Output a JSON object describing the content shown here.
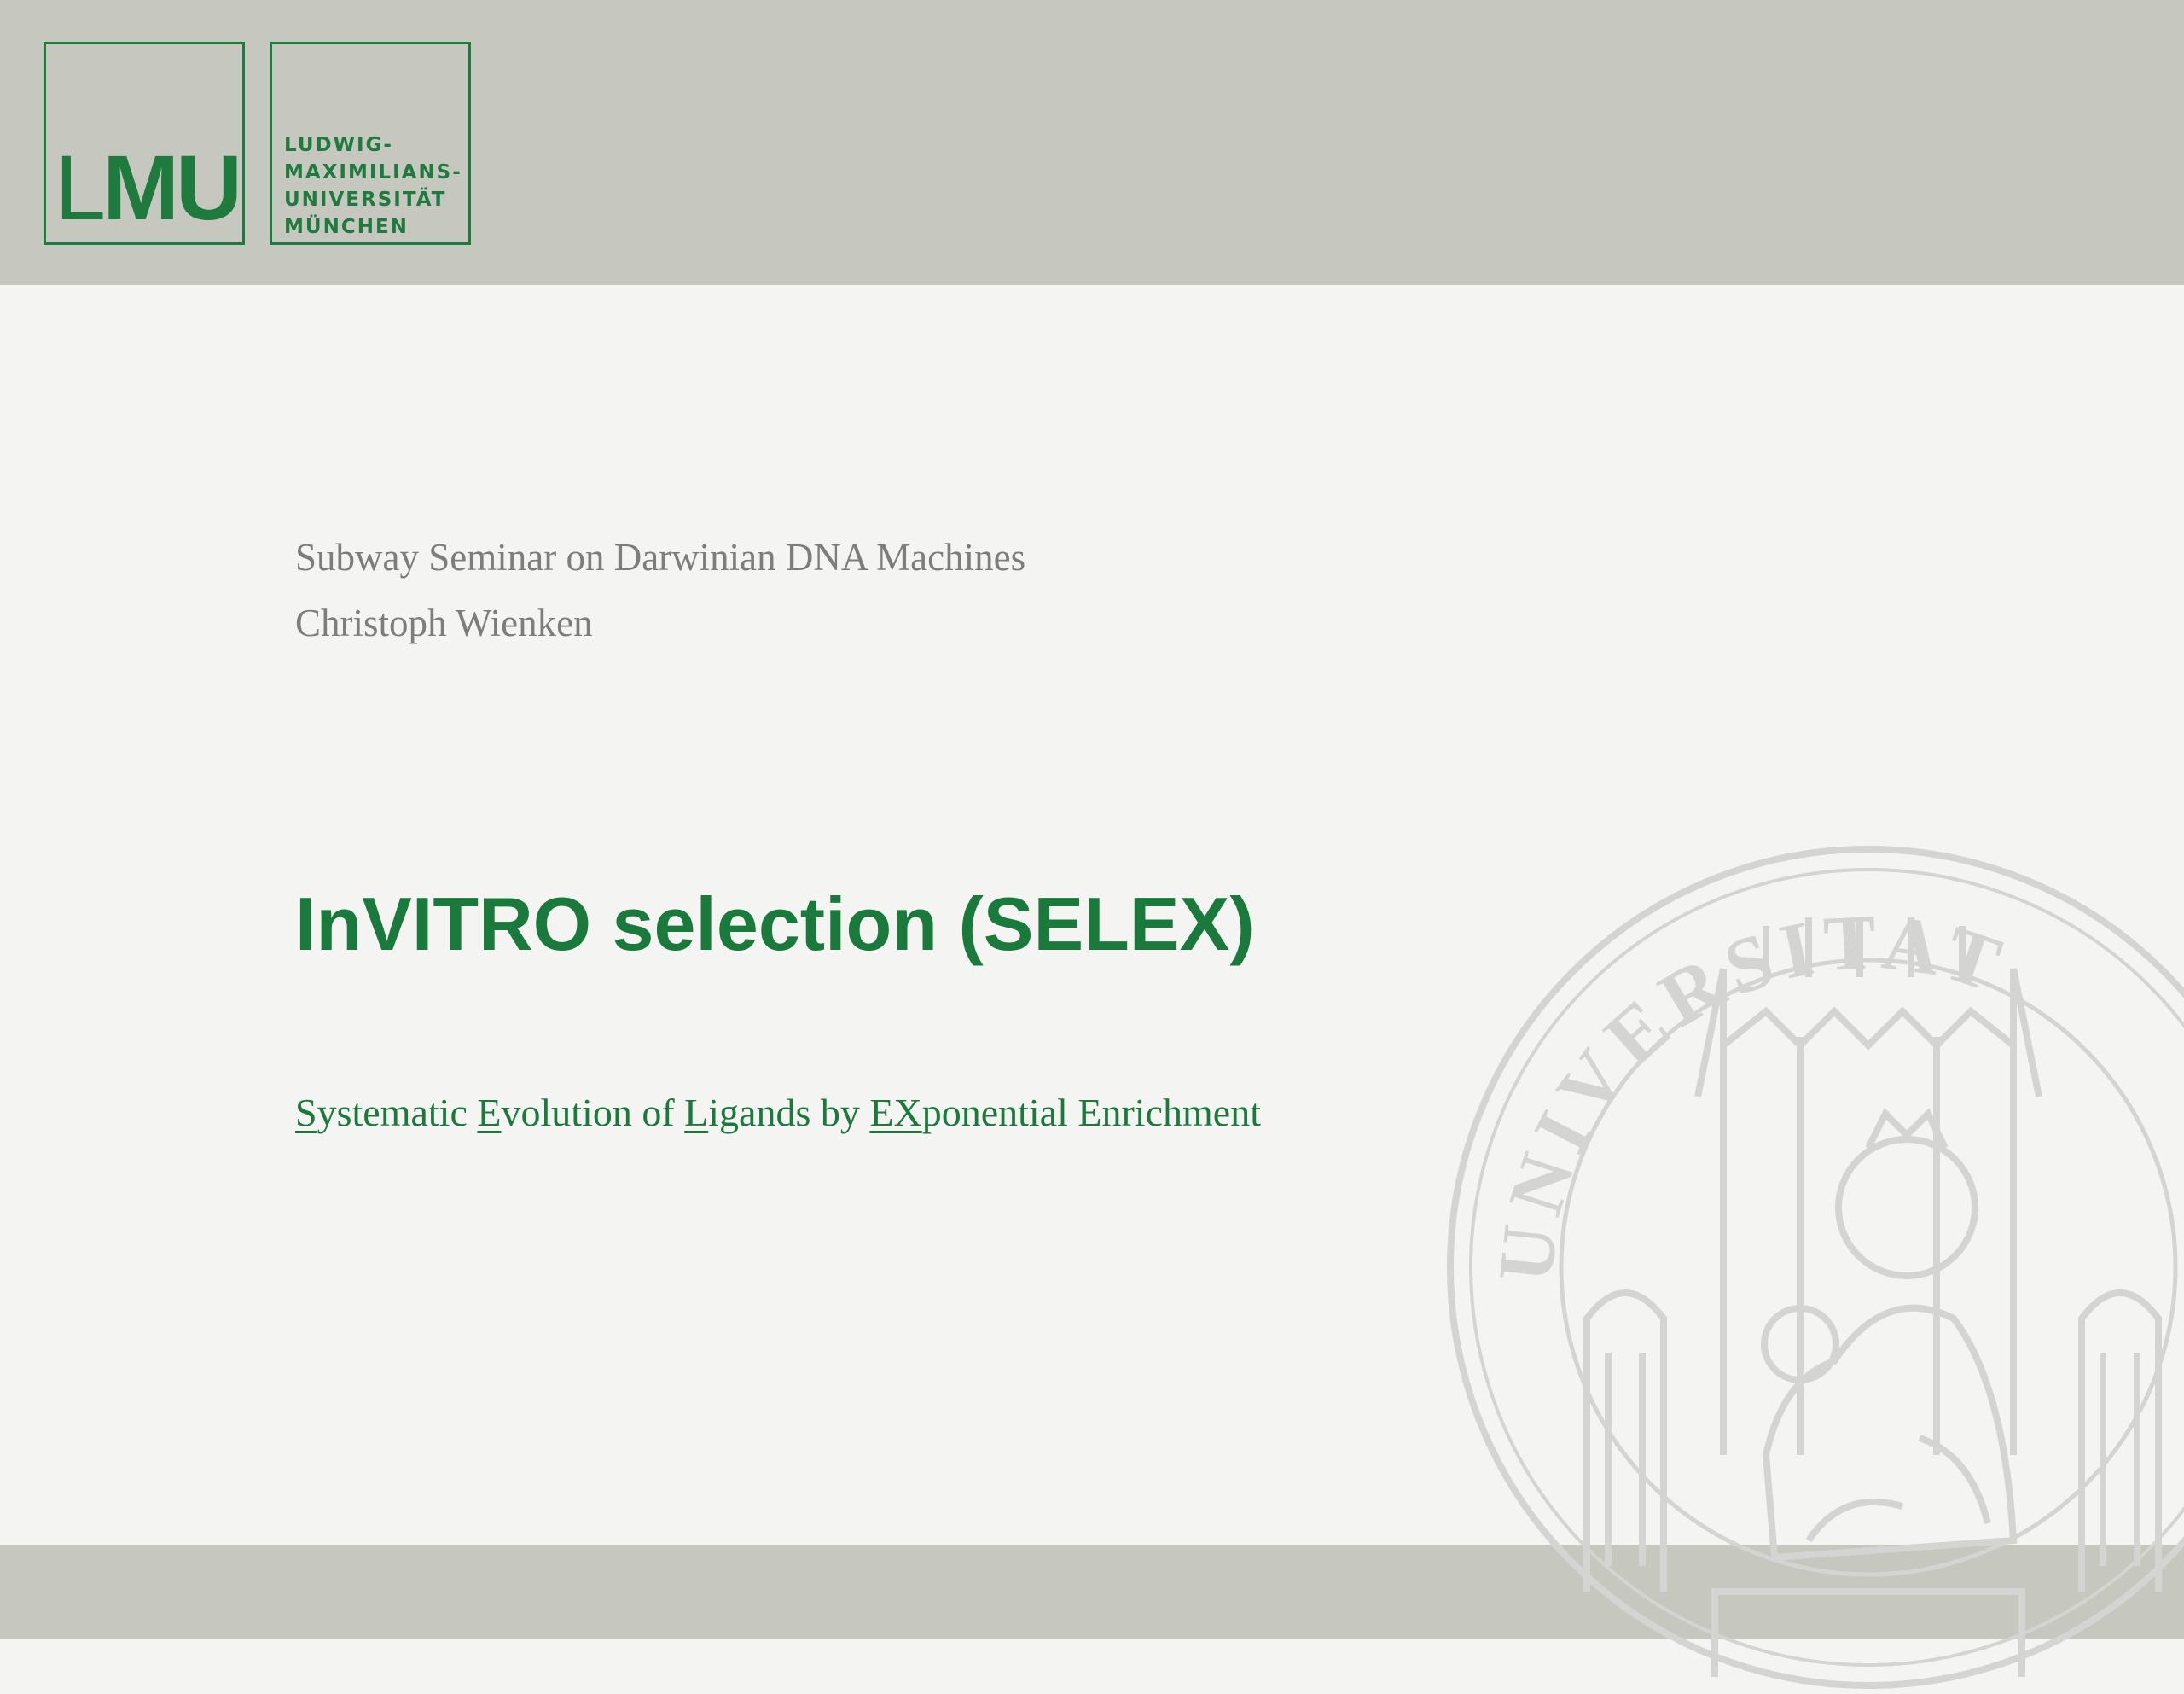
{
  "logo": {
    "mark": {
      "l": "L",
      "mu": "MU"
    },
    "words": [
      "LUDWIG-",
      "MAXIMILIANS-",
      "UNIVERSITÄT",
      "MÜNCHEN"
    ],
    "color": "#1f7a3e"
  },
  "seal": {
    "icon": "university-seal-icon",
    "lettering": "UNIVERSITAT"
  },
  "slide": {
    "seminar": "Subway Seminar on Darwinian DNA Machines",
    "author": "Christoph Wienken",
    "title": "InVITRO selection (SELEX)",
    "acronym_parts": [
      {
        "text": "S",
        "underline": true
      },
      {
        "text": "ystematic ",
        "underline": false
      },
      {
        "text": "E",
        "underline": true
      },
      {
        "text": "volution of ",
        "underline": false
      },
      {
        "text": "L",
        "underline": true
      },
      {
        "text": "igands by ",
        "underline": false
      },
      {
        "text": "EX",
        "underline": true
      },
      {
        "text": "ponential Enrichment",
        "underline": false
      }
    ]
  },
  "colors": {
    "band": "#c6c7bf",
    "background": "#f4f4f2",
    "accent": "#1a7a3c",
    "muted": "#7d7d7d"
  }
}
